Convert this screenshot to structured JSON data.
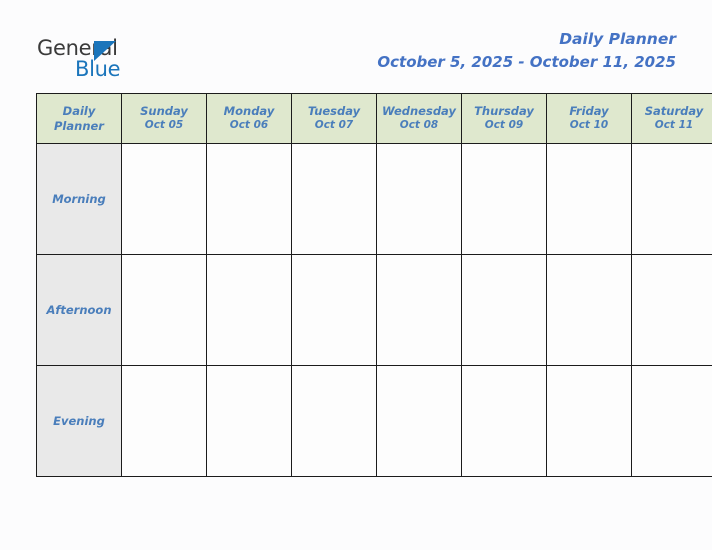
{
  "brand": {
    "name_part1": "General",
    "name_part2": "Blue",
    "triangle_icon": "triangle-icon",
    "color_dark": "#3a3a3a",
    "color_blue": "#1b75bb"
  },
  "header": {
    "title": "Daily Planner",
    "date_range": "October 5, 2025 - October 11, 2025",
    "title_color": "#4472c4"
  },
  "table": {
    "corner_label_line1": "Daily",
    "corner_label_line2": "Planner",
    "header_bg": "#dfe8ce",
    "label_bg": "#e9e9e9",
    "text_color": "#4a7ebb",
    "border_color": "#1c1c1c",
    "columns": [
      {
        "day": "Sunday",
        "date": "Oct 05"
      },
      {
        "day": "Monday",
        "date": "Oct 06"
      },
      {
        "day": "Tuesday",
        "date": "Oct 07"
      },
      {
        "day": "Wednesday",
        "date": "Oct 08"
      },
      {
        "day": "Thursday",
        "date": "Oct 09"
      },
      {
        "day": "Friday",
        "date": "Oct 10"
      },
      {
        "day": "Saturday",
        "date": "Oct 11"
      }
    ],
    "rows": [
      {
        "label": "Morning",
        "cells": [
          "",
          "",
          "",
          "",
          "",
          "",
          ""
        ]
      },
      {
        "label": "Afternoon",
        "cells": [
          "",
          "",
          "",
          "",
          "",
          "",
          ""
        ]
      },
      {
        "label": "Evening",
        "cells": [
          "",
          "",
          "",
          "",
          "",
          "",
          ""
        ]
      }
    ]
  }
}
